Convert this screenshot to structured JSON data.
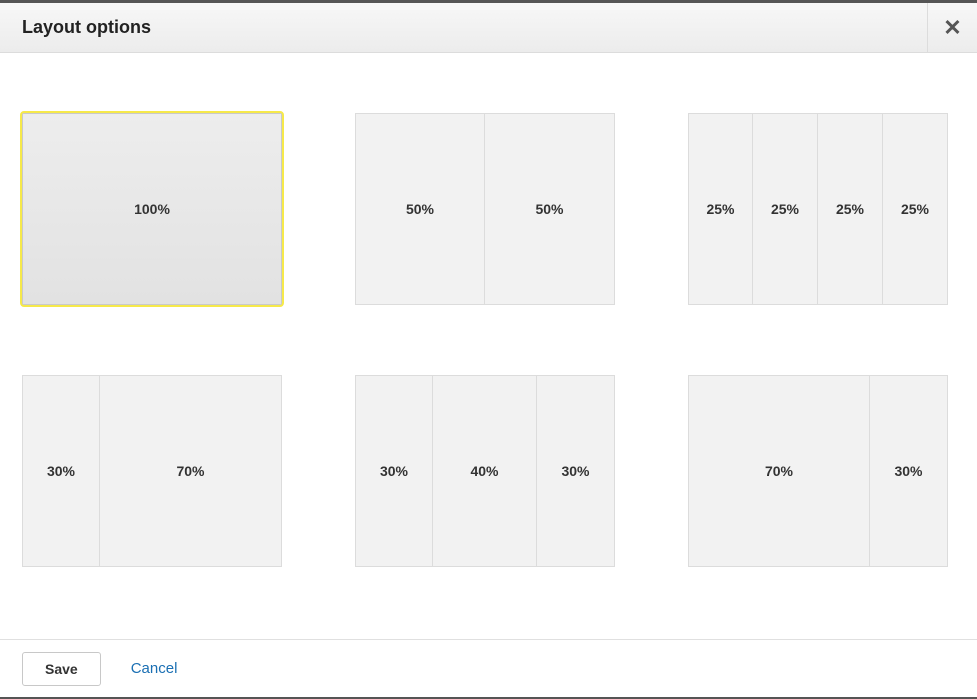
{
  "header": {
    "title": "Layout options",
    "close_glyph": "✕"
  },
  "layouts": [
    {
      "selected": true,
      "cols": [
        {
          "pct": 100,
          "label": "100%"
        }
      ]
    },
    {
      "selected": false,
      "cols": [
        {
          "pct": 50,
          "label": "50%"
        },
        {
          "pct": 50,
          "label": "50%"
        }
      ]
    },
    {
      "selected": false,
      "cols": [
        {
          "pct": 25,
          "label": "25%"
        },
        {
          "pct": 25,
          "label": "25%"
        },
        {
          "pct": 25,
          "label": "25%"
        },
        {
          "pct": 25,
          "label": "25%"
        }
      ]
    },
    {
      "selected": false,
      "cols": [
        {
          "pct": 30,
          "label": "30%"
        },
        {
          "pct": 70,
          "label": "70%"
        }
      ]
    },
    {
      "selected": false,
      "cols": [
        {
          "pct": 30,
          "label": "30%"
        },
        {
          "pct": 40,
          "label": "40%"
        },
        {
          "pct": 30,
          "label": "30%"
        }
      ]
    },
    {
      "selected": false,
      "cols": [
        {
          "pct": 70,
          "label": "70%"
        },
        {
          "pct": 30,
          "label": "30%"
        }
      ]
    }
  ],
  "footer": {
    "save_label": "Save",
    "cancel_label": "Cancel"
  }
}
